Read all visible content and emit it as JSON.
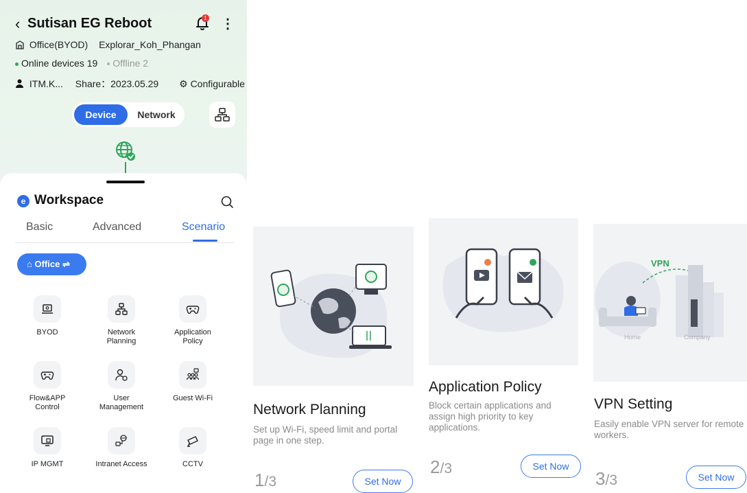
{
  "header": {
    "title": "Sutisan EG Reboot",
    "notification_count": "1",
    "network_scenario": "Office(BYOD)",
    "ssid": "Explorar_Koh_Phangan",
    "online_devices": "Online devices 19",
    "offline_devices": "Offline 2",
    "owner": "ITM.K...",
    "share": "Share：2023.05.29",
    "configurable": "Configurable"
  },
  "view_toggle": {
    "device": "Device",
    "network": "Network",
    "selected": "Device"
  },
  "workspace": {
    "title": "Workspace",
    "tabs": [
      "Basic",
      "Advanced",
      "Scenario"
    ],
    "active_tab": "Scenario",
    "scenario_chip": "Office",
    "features": [
      {
        "label": "BYOD",
        "icon": "laptop-icon"
      },
      {
        "label": "Network Planning",
        "icon": "topology-icon"
      },
      {
        "label": "Application Policy",
        "icon": "gamepad-icon"
      },
      {
        "label": "Flow&APP Control",
        "icon": "gamepad-icon"
      },
      {
        "label": "User Management",
        "icon": "user-settings-icon"
      },
      {
        "label": "Guest Wi-Fi",
        "icon": "users-group-icon"
      },
      {
        "label": "IP MGMT",
        "icon": "monitor-icon"
      },
      {
        "label": "Intranet Access",
        "icon": "intranet-icon"
      },
      {
        "label": "CCTV",
        "icon": "camera-icon"
      }
    ]
  },
  "cards": [
    {
      "title": "Network Planning",
      "description": "Set up Wi-Fi, speed limit and portal page in one step.",
      "page": "1",
      "total": "3",
      "button": "Set Now"
    },
    {
      "title": "Application Policy",
      "description": "Block certain applications and assign high priority to key applications.",
      "page": "2",
      "total": "3",
      "button": "Set Now"
    },
    {
      "title": "VPN Setting",
      "description": "Easily enable VPN server for remote workers.",
      "page": "3",
      "total": "3",
      "button": "Set Now",
      "illustration_labels": {
        "vpn": "VPN",
        "home": "Home",
        "company": "Company"
      }
    }
  ],
  "colors": {
    "accent": "#2f6de6",
    "online": "#34a853",
    "header_bg": "#e8f4eb"
  }
}
